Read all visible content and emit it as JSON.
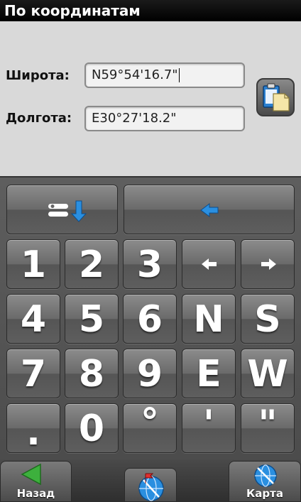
{
  "title": "По координатам",
  "form": {
    "latitude_label": "Широта:",
    "latitude_value": "N59°54'16.7\"",
    "longitude_label": "Долгота:",
    "longitude_value": "E30°27'18.2\"",
    "paste_icon": "clipboard-paste-icon"
  },
  "keypad": {
    "switch_icon": "switch-field-icon",
    "backspace_icon": "backspace-icon",
    "row1": [
      "1",
      "2",
      "3"
    ],
    "row2": [
      "4",
      "5",
      "6",
      "N",
      "S"
    ],
    "row3": [
      "7",
      "8",
      "9",
      "E",
      "W"
    ],
    "row4": [
      ".",
      "0",
      "°",
      "'",
      "\""
    ],
    "cursor_left_icon": "arrow-left-icon",
    "cursor_right_icon": "arrow-right-icon"
  },
  "bottombar": {
    "back_label": "Назад",
    "map_label": "Карта",
    "center_icon": "globe-flag-icon"
  },
  "colors": {
    "accent_blue": "#2a8fe0",
    "back_green": "#3db03d"
  }
}
